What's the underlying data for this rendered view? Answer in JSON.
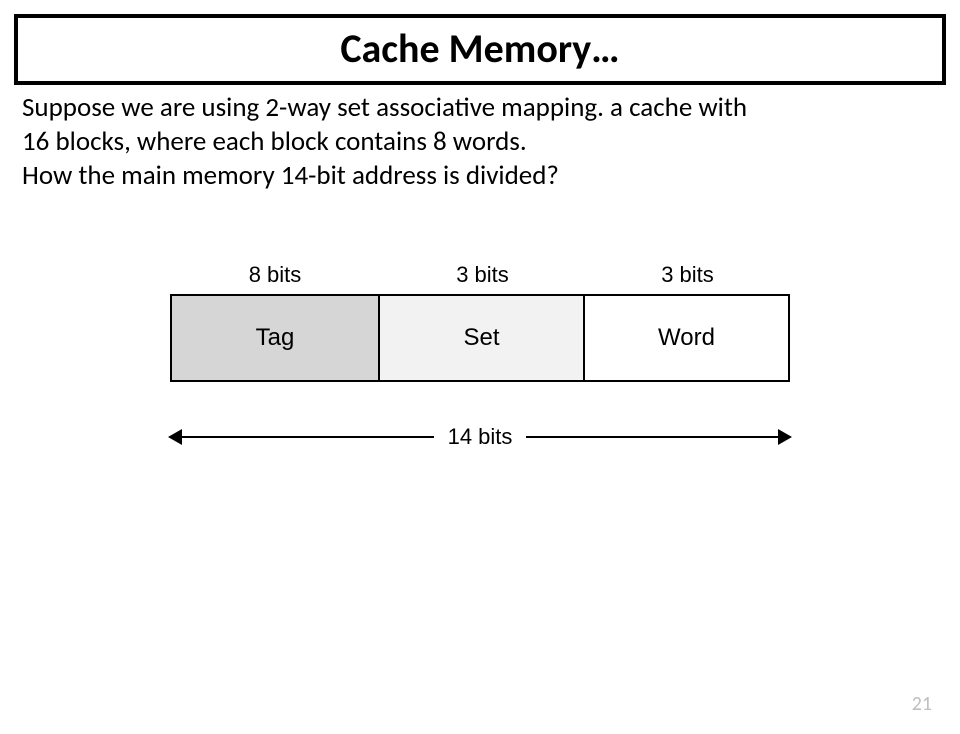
{
  "title": "Cache Memory…",
  "paragraph": {
    "line1": "Suppose we are using 2-way set associative mapping. a cache with",
    "line2": "16 blocks, where each block contains 8 words.",
    "line3": "How  the main memory 14-bit address is divided?"
  },
  "diagram": {
    "labels": {
      "tag_bits": "8 bits",
      "set_bits": "3 bits",
      "word_bits": "3 bits"
    },
    "fields": {
      "tag": "Tag",
      "set": "Set",
      "word": "Word"
    },
    "total": "14 bits"
  },
  "page_number": "21"
}
